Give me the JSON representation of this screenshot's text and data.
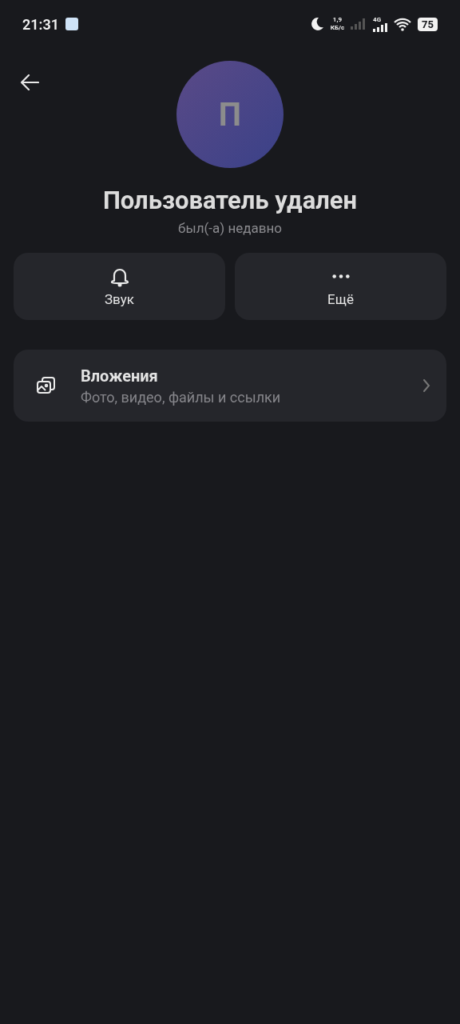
{
  "status_bar": {
    "time": "21:31",
    "speed_value": "1,9",
    "speed_unit": "КБ/с",
    "network": "4G",
    "battery": "75"
  },
  "profile": {
    "avatar_letter": "П",
    "name": "Пользователь удален",
    "last_seen": "был(-а) недавно"
  },
  "actions": [
    {
      "kind": "sound",
      "label": "Звук"
    },
    {
      "kind": "more",
      "label": "Ещё"
    }
  ],
  "attachments": {
    "title": "Вложения",
    "subtitle": "Фото, видео, файлы и ссылки"
  }
}
